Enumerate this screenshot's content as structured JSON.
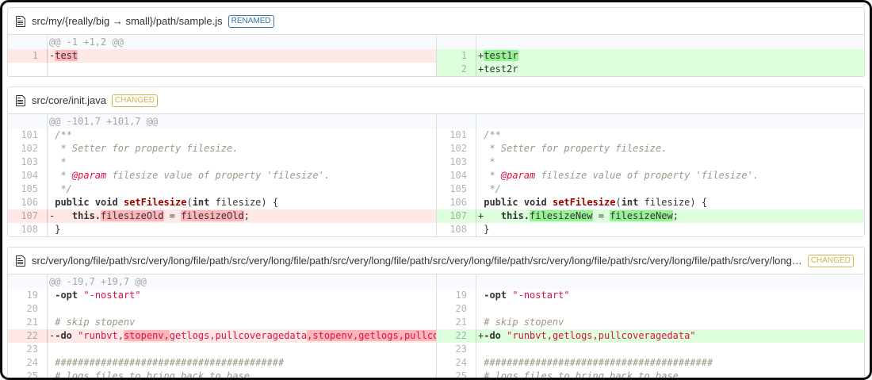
{
  "colors": {
    "renamed_accent": "#3572b0",
    "changed_accent": "#d0b44c",
    "deleted_line_bg": "#fee8e8",
    "inserted_line_bg": "#ddffdd",
    "deleted_word_bg": "#ffb6ba",
    "inserted_word_bg": "#97f295",
    "hunk_header_bg": "#f8fafd"
  },
  "files": [
    {
      "name": "src/my/{really/big → small}/path/sample.js",
      "tag": {
        "label": "RENAMED",
        "color": "#3572b0"
      },
      "hunk": "@@ -1 +1,2 @@",
      "left": {
        "rows": [
          {
            "t": "hunk",
            "s": [
              [
                "@@ -1 +1,2 @@",
                "hh"
              ]
            ]
          },
          {
            "n": "1",
            "t": "del",
            "s": [
              [
                "-",
                ""
              ],
              [
                "test",
                "wdel"
              ]
            ]
          },
          {
            "t": "fill",
            "s": []
          }
        ]
      },
      "right": {
        "rows": [
          {
            "t": "pad",
            "s": []
          },
          {
            "n": "1",
            "t": "ins",
            "s": [
              [
                "+",
                ""
              ],
              [
                "test1r",
                "wins"
              ]
            ]
          },
          {
            "n": "2",
            "t": "ins",
            "s": [
              [
                "+test2r",
                ""
              ]
            ]
          }
        ]
      }
    },
    {
      "name": "src/core/init.java",
      "tag": {
        "label": "CHANGED",
        "color": "#d0b44c"
      },
      "hunk": "@@ -101,7 +101,7 @@",
      "left": {
        "rows": [
          {
            "t": "hunk",
            "s": [
              [
                "@@ -101,7 +101,7 @@",
                "hh"
              ]
            ]
          },
          {
            "n": "101",
            "t": "ctx",
            "s": [
              [
                " /**",
                "c"
              ]
            ]
          },
          {
            "n": "102",
            "t": "ctx",
            "s": [
              [
                "  * Setter for property filesize.",
                "c"
              ]
            ]
          },
          {
            "n": "103",
            "t": "ctx",
            "s": [
              [
                "  *",
                "c"
              ]
            ]
          },
          {
            "n": "104",
            "t": "ctx",
            "s": [
              [
                "  * ",
                "c"
              ],
              [
                "@param",
                "d"
              ],
              [
                " filesize value of property 'filesize'.",
                "c"
              ]
            ]
          },
          {
            "n": "105",
            "t": "ctx",
            "s": [
              [
                "  */",
                "c"
              ]
            ]
          },
          {
            "n": "106",
            "t": "ctx",
            "s": [
              [
                " ",
                ""
              ],
              [
                "public",
                "k"
              ],
              [
                " ",
                ""
              ],
              [
                "void",
                "k"
              ],
              [
                " ",
                ""
              ],
              [
                "setFilesize",
                "t"
              ],
              [
                "(",
                ""
              ],
              [
                "int",
                "k"
              ],
              [
                " filesize) {",
                ""
              ]
            ]
          },
          {
            "n": "107",
            "t": "del",
            "s": [
              [
                "-   ",
                ""
              ],
              [
                "this.",
                "k"
              ],
              [
                "filesizeOld",
                "wdel"
              ],
              [
                " = ",
                ""
              ],
              [
                "filesizeOld",
                "wdel"
              ],
              [
                ";",
                ""
              ]
            ]
          },
          {
            "n": "108",
            "t": "ctx",
            "s": [
              [
                " }",
                ""
              ]
            ]
          }
        ]
      },
      "right": {
        "rows": [
          {
            "t": "pad",
            "s": []
          },
          {
            "n": "101",
            "t": "ctx",
            "s": [
              [
                " /**",
                "c"
              ]
            ]
          },
          {
            "n": "102",
            "t": "ctx",
            "s": [
              [
                "  * Setter for property filesize.",
                "c"
              ]
            ]
          },
          {
            "n": "103",
            "t": "ctx",
            "s": [
              [
                "  *",
                "c"
              ]
            ]
          },
          {
            "n": "104",
            "t": "ctx",
            "s": [
              [
                "  * ",
                "c"
              ],
              [
                "@param",
                "d"
              ],
              [
                " filesize value of property 'filesize'.",
                "c"
              ]
            ]
          },
          {
            "n": "105",
            "t": "ctx",
            "s": [
              [
                "  */",
                "c"
              ]
            ]
          },
          {
            "n": "106",
            "t": "ctx",
            "s": [
              [
                " ",
                ""
              ],
              [
                "public",
                "k"
              ],
              [
                " ",
                ""
              ],
              [
                "void",
                "k"
              ],
              [
                " ",
                ""
              ],
              [
                "setFilesize",
                "t"
              ],
              [
                "(",
                ""
              ],
              [
                "int",
                "k"
              ],
              [
                " filesize) {",
                ""
              ]
            ]
          },
          {
            "n": "107",
            "t": "ins",
            "s": [
              [
                "+   ",
                ""
              ],
              [
                "this.",
                "k"
              ],
              [
                "filesizeNew",
                "wins"
              ],
              [
                " = ",
                ""
              ],
              [
                "filesizeNew",
                "wins"
              ],
              [
                ";",
                ""
              ]
            ]
          },
          {
            "n": "108",
            "t": "ctx",
            "s": [
              [
                " }",
                ""
              ]
            ]
          }
        ]
      }
    },
    {
      "name": "src/very/long/file/path/src/very/long/file/path/src/very/long/file/path/src/very/long/file/path/src/very/long/file/path/src/very/long/file/path/src/very/long/file/path/src/very/long…",
      "tag": {
        "label": "CHANGED",
        "color": "#d0b44c"
      },
      "hunk": "@@ -19,7 +19,7 @@",
      "left": {
        "rows": [
          {
            "t": "hunk",
            "s": [
              [
                "@@ -19,7 +19,7 @@",
                "hh"
              ]
            ]
          },
          {
            "n": "19",
            "t": "ctx",
            "s": [
              [
                " ",
                ""
              ],
              [
                "-opt",
                "k"
              ],
              [
                " ",
                ""
              ],
              [
                "\"-nostart\"",
                "s"
              ]
            ]
          },
          {
            "n": "20",
            "t": "ctx",
            "s": []
          },
          {
            "n": "21",
            "t": "ctx",
            "s": [
              [
                " ",
                ""
              ],
              [
                "# skip stopenv",
                "c"
              ]
            ]
          },
          {
            "n": "22",
            "t": "del",
            "s": [
              [
                "-",
                ""
              ],
              [
                "-do",
                "k"
              ],
              [
                " ",
                ""
              ],
              [
                "\"runbvt,",
                "s"
              ],
              [
                "stopenv,",
                "s wdel"
              ],
              [
                "getlogs,pullcoveragedata",
                "s"
              ],
              [
                ",stopenv,getlogs,pullcoveragedata\"",
                "s wdel"
              ]
            ]
          },
          {
            "n": "23",
            "t": "ctx",
            "s": []
          },
          {
            "n": "24",
            "t": "ctx",
            "s": [
              [
                " ",
                ""
              ],
              [
                "########################################",
                "c"
              ]
            ]
          },
          {
            "n": "25",
            "t": "ctx",
            "s": [
              [
                " ",
                ""
              ],
              [
                "# logs files to bring back to base",
                "c"
              ]
            ]
          }
        ]
      },
      "right": {
        "rows": [
          {
            "t": "pad",
            "s": []
          },
          {
            "n": "19",
            "t": "ctx",
            "s": [
              [
                " ",
                ""
              ],
              [
                "-opt",
                "k"
              ],
              [
                " ",
                ""
              ],
              [
                "\"-nostart\"",
                "s"
              ]
            ]
          },
          {
            "n": "20",
            "t": "ctx",
            "s": []
          },
          {
            "n": "21",
            "t": "ctx",
            "s": [
              [
                " ",
                ""
              ],
              [
                "# skip stopenv",
                "c"
              ]
            ]
          },
          {
            "n": "22",
            "t": "ins",
            "s": [
              [
                "+",
                ""
              ],
              [
                "-do",
                "k"
              ],
              [
                " ",
                ""
              ],
              [
                "\"runbvt,getlogs,pullcoveragedata\"",
                "s"
              ]
            ]
          },
          {
            "n": "23",
            "t": "ctx",
            "s": []
          },
          {
            "n": "24",
            "t": "ctx",
            "s": [
              [
                " ",
                ""
              ],
              [
                "########################################",
                "c"
              ]
            ]
          },
          {
            "n": "25",
            "t": "ctx",
            "s": [
              [
                " ",
                ""
              ],
              [
                "# logs files to bring back to base",
                "c"
              ]
            ]
          }
        ]
      }
    }
  ]
}
